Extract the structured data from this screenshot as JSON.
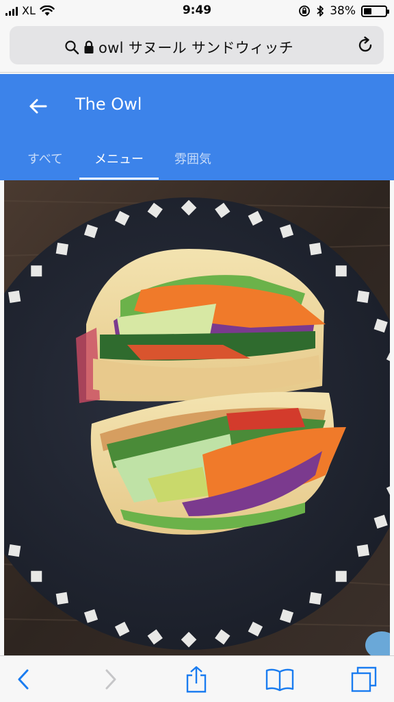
{
  "status_bar": {
    "carrier": "XL",
    "time": "9:49",
    "battery_percent_label": "38%",
    "battery_level": 0.38,
    "icons": [
      "signal-icon",
      "wifi-icon",
      "orientation-lock-icon",
      "bluetooth-icon",
      "battery-icon"
    ]
  },
  "browser": {
    "url_text": "owl サヌール サンドウィッチ",
    "icons": [
      "search-icon",
      "lock-icon",
      "reload-icon"
    ]
  },
  "app": {
    "title": "The Owl",
    "tabs": [
      {
        "label": "すべて",
        "active": false
      },
      {
        "label": "メニュー",
        "active": true
      },
      {
        "label": "雰囲気",
        "active": false
      }
    ],
    "accent_color": "#3c83ea"
  },
  "photo": {
    "subject": "vegetable-sandwich-photo"
  },
  "toolbar": {
    "buttons": [
      "back-icon",
      "forward-icon",
      "share-icon",
      "bookmarks-icon",
      "tabs-icon"
    ],
    "tint_color": "#1a7cf0"
  }
}
